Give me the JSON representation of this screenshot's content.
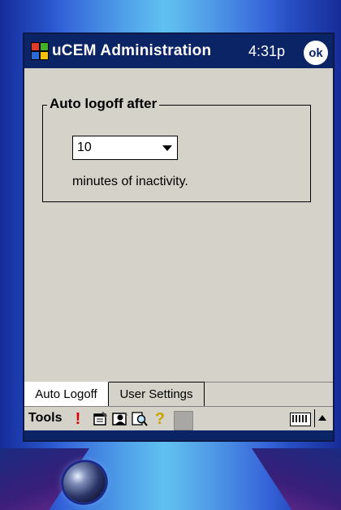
{
  "titlebar": {
    "title": "uCEM Administration",
    "time": "4:31p",
    "ok_label": "ok"
  },
  "group": {
    "legend": "Auto logoff after"
  },
  "dropdown": {
    "selected_value": "10"
  },
  "inactivity_label": "minutes of inactivity.",
  "tabs": [
    {
      "label": "Auto Logoff",
      "active": true
    },
    {
      "label": "User Settings",
      "active": false
    }
  ],
  "menubar": {
    "tools_label": "Tools",
    "icons": [
      "exclamation-icon",
      "properties-icon",
      "user-icon",
      "find-icon",
      "help-icon",
      "blank-icon"
    ],
    "exclaim_glyph": "!",
    "question_glyph": "?"
  },
  "colors": {
    "titlebar_bg": "#0a2466",
    "screen_bg": "#d5d2c9",
    "exclaim": "#e00000"
  }
}
